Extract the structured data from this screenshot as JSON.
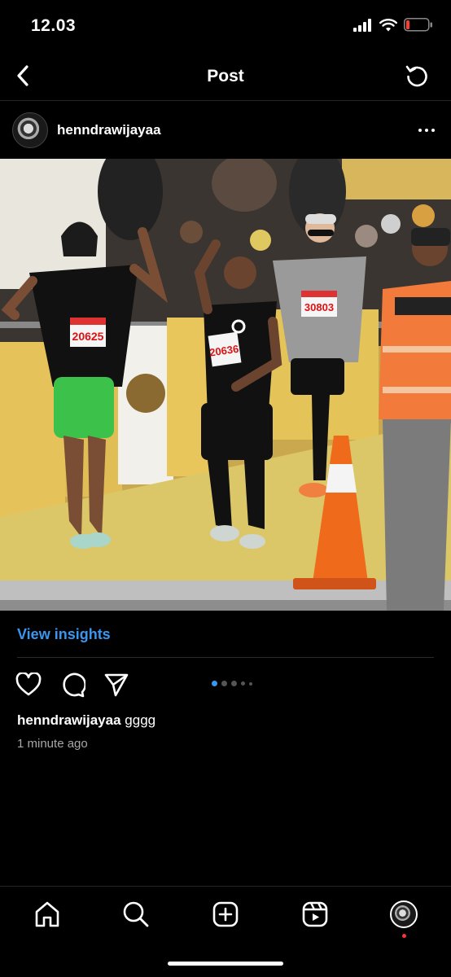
{
  "status_bar": {
    "time": "12.03",
    "icons": [
      "cellular-signal-icon",
      "wifi-icon",
      "battery-low-icon"
    ],
    "battery_color": "#ff3b30"
  },
  "nav": {
    "title": "Post",
    "back_icon": "chevron-left-icon",
    "refresh_icon": "refresh-icon"
  },
  "post": {
    "username": "henndrawijayaa",
    "more_icon": "more-horizontal-icon",
    "photo": {
      "description_icon": "marathon-photo",
      "bibs": [
        "20625",
        "20636",
        "30803"
      ]
    },
    "view_insights": "View insights",
    "actions": {
      "like_icon": "heart-icon",
      "comment_icon": "comment-icon",
      "share_icon": "send-icon"
    },
    "carousel": {
      "current": 1,
      "dots": 5
    },
    "caption_user": "henndrawijayaa",
    "caption_text": "gggg",
    "timestamp": "1 minute ago"
  },
  "colors": {
    "accent": "#3897f0",
    "background": "#000000",
    "notification": "#ff3040"
  },
  "tab_bar": {
    "items": [
      "home-icon",
      "search-icon",
      "create-icon",
      "reels-icon",
      "profile-avatar"
    ]
  }
}
